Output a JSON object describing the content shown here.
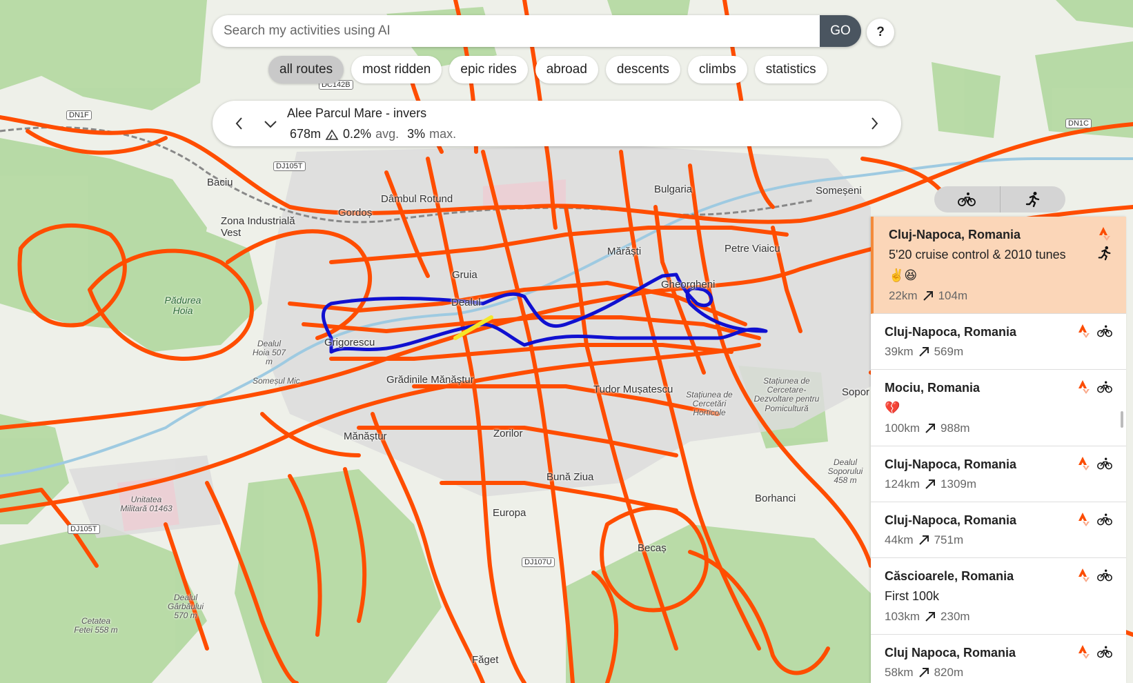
{
  "search": {
    "placeholder": "Search my activities using AI",
    "go_label": "GO",
    "help_label": "?"
  },
  "filters": [
    {
      "label": "all routes",
      "active": true
    },
    {
      "label": "most ridden",
      "active": false
    },
    {
      "label": "epic rides",
      "active": false
    },
    {
      "label": "abroad",
      "active": false
    },
    {
      "label": "descents",
      "active": false
    },
    {
      "label": "climbs",
      "active": false
    },
    {
      "label": "statistics",
      "active": false
    }
  ],
  "segment": {
    "name": "Alee Parcul Mare - invers",
    "length": "678m",
    "avg_grade": "0.2%",
    "avg_label": "avg.",
    "max_grade": "3%",
    "max_label": "max."
  },
  "sport_toggle": {
    "options": [
      "bike-icon",
      "run-icon"
    ]
  },
  "activities": [
    {
      "location": "Cluj-Napoca, Romania",
      "description": "5'20 cruise control & 2010 tunes",
      "emoji": "✌️😆",
      "distance": "22km",
      "elevation": "104m",
      "sport": "run",
      "selected": true
    },
    {
      "location": "Cluj-Napoca, Romania",
      "description": "",
      "emoji": "",
      "distance": "39km",
      "elevation": "569m",
      "sport": "bike",
      "selected": false
    },
    {
      "location": "Mociu, Romania",
      "description": "",
      "emoji": "💔",
      "distance": "100km",
      "elevation": "988m",
      "sport": "bike",
      "selected": false
    },
    {
      "location": "Cluj-Napoca, Romania",
      "description": "",
      "emoji": "",
      "distance": "124km",
      "elevation": "1309m",
      "sport": "bike",
      "selected": false
    },
    {
      "location": "Cluj-Napoca, Romania",
      "description": "",
      "emoji": "",
      "distance": "44km",
      "elevation": "751m",
      "sport": "bike",
      "selected": false
    },
    {
      "location": "Căscioarele, Romania",
      "description": "First 100k",
      "emoji": "",
      "distance": "103km",
      "elevation": "230m",
      "sport": "bike",
      "selected": false
    },
    {
      "location": "Cluj Napoca, Romania",
      "description": "",
      "emoji": "",
      "distance": "58km",
      "elevation": "820m",
      "sport": "bike",
      "selected": false
    }
  ],
  "map": {
    "labels": {
      "dambul": "Dâmbul Rotund",
      "bulgaria": "Bulgaria",
      "somesen": "Someșeni",
      "gruia": "Gruia",
      "baciu": "Baciu",
      "zona": "Zona Industrială Vest",
      "gordos": "Gordoș",
      "padurea": "Pădurea Hoia",
      "dealul_hoia": "Dealul Hoia 507 m",
      "grigorescu": "Grigorescu",
      "manastur": "Grădinile Mănăștur",
      "marasti": "Mărăști",
      "trei": "Petre Viaicu",
      "gheorgheni": "Gheorgheni",
      "dealul": "Dealul",
      "zorilor": "Zorilor",
      "buna": "Bună Ziua",
      "europa": "Europa",
      "borhanci": "Borhanci",
      "becas": "Becaș",
      "faget": "Făget",
      "sopor": "Sopor",
      "sopor_hill": "Dealul Soporului 458 m",
      "garbau": "Dealul Gârbăului 570 m",
      "cetatea": "Cetatea Fetei 558 m",
      "unitatea": "Unitatea Militară 01463",
      "statiunea": "Stațiunea de Cercetare-Dezvoltare pentru Pomicultură",
      "statiunea2": "Stațiunea de Cercetări Horticole",
      "someseni_river": "Someșul Mic",
      "tudor": "Tudor Mușatescu",
      "manastur_short": "Mănăștur"
    },
    "roads": [
      "DC142B",
      "DJ105T",
      "DJ105T",
      "DJ107U",
      "DN1C",
      "DN1F"
    ],
    "colors": {
      "routes": "#ff4d00",
      "selected": "#1010d0",
      "highlight": "#f5e62a"
    }
  }
}
